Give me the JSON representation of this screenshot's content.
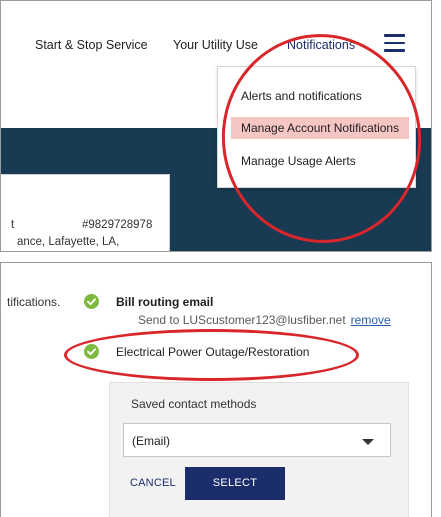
{
  "top_panel": {
    "nav": {
      "start_stop": "Start & Stop Service",
      "utility_usage": "Your Utility Use",
      "notifications": "Notifications"
    },
    "dropdown": {
      "items": [
        "Alerts and notifications",
        "Manage Account Notifications",
        "Manage Usage Alerts"
      ]
    },
    "account_card": {
      "letter": "t",
      "number": "#9829728978",
      "address": "ance, Lafayette, LA,"
    }
  },
  "bottom_panel": {
    "notifications_prefix": "tifications.",
    "bill_routing": {
      "title": "Bill routing email",
      "send_prefix": "Send to",
      "email": "LUScustomer123@lusfiber.net",
      "remove": "remove"
    },
    "power_outage_label": "Electrical Power Outage/Restoration",
    "contact_methods": {
      "title": "Saved contact methods",
      "selected": "(Email)",
      "cancel": "CANCEL",
      "select": "SELECT"
    }
  },
  "colors": {
    "brand_navy": "#1b2d6b",
    "hero_blue": "#183a52",
    "check_green": "#7cbb3f",
    "highlight": "#f5c6c4",
    "annotation_red": "#d8262b"
  },
  "icons": [
    "hamburger-menu-icon",
    "green-check-icon",
    "chevron-down-icon"
  ]
}
